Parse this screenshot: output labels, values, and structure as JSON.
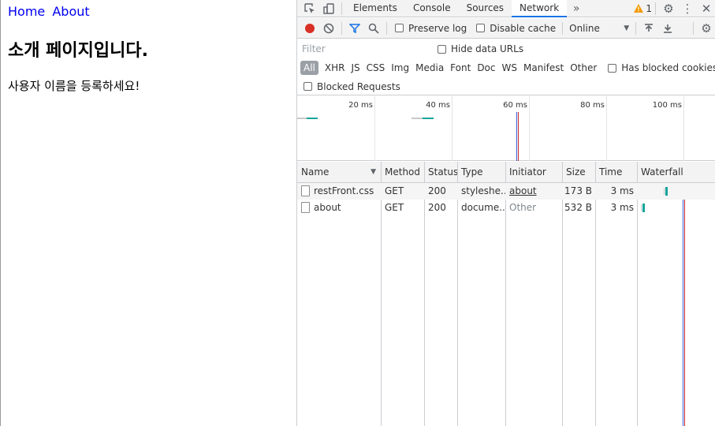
{
  "page": {
    "nav": [
      "Home",
      "About"
    ],
    "title": "소개 페이지입니다.",
    "text": "사용자 이름을 등록하세요!"
  },
  "devtools": {
    "tabs": [
      "Elements",
      "Console",
      "Sources",
      "Network"
    ],
    "active_tab": "Network",
    "warning_count": "1",
    "toolbar": {
      "preserve_log": "Preserve log",
      "disable_cache": "Disable cache",
      "throttling": "Online"
    },
    "filter": {
      "placeholder": "Filter",
      "hide_data_urls": "Hide data URLs"
    },
    "types": [
      "All",
      "XHR",
      "JS",
      "CSS",
      "Img",
      "Media",
      "Font",
      "Doc",
      "WS",
      "Manifest",
      "Other"
    ],
    "has_blocked_cookies": "Has blocked cookies",
    "blocked_requests": "Blocked Requests",
    "overview_ticks": [
      "20 ms",
      "40 ms",
      "60 ms",
      "80 ms",
      "100 ms"
    ],
    "columns": [
      "Name",
      "Method",
      "Status",
      "Type",
      "Initiator",
      "Size",
      "Time",
      "Waterfall"
    ],
    "rows": [
      {
        "name": "restFront.css",
        "method": "GET",
        "status": "200",
        "type": "styleshe...",
        "initiator": "about",
        "size": "173 B",
        "time": "3 ms"
      },
      {
        "name": "about",
        "method": "GET",
        "status": "200",
        "type": "docume...",
        "initiator": "Other",
        "size": "532 B",
        "time": "3 ms"
      }
    ],
    "colors": {
      "accent": "#1a73e8",
      "record": "#d93025",
      "bar": "#13a39a",
      "dom_line": "#3b5bdb",
      "load_line": "#c92a2a"
    }
  }
}
